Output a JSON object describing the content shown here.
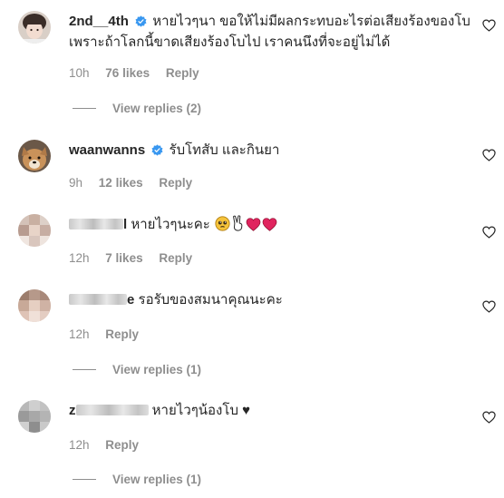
{
  "comments": [
    {
      "username": "2nd__4th",
      "verified": true,
      "text_line1": "หายไวๆนา ขอให้ไม่มีผลกระทบอะไรต่อเสียงร้องของโบ",
      "text_line2": "เพราะถ้าโลกนี้ขาดเสียงร้องโบไป เราคนนึงที่จะอยู่ไม่ได้",
      "time": "10h",
      "likes": "76 likes",
      "reply": "Reply",
      "view_replies": "View replies (2)"
    },
    {
      "username": "waanwanns",
      "verified": true,
      "text": "รับโทสับ และกินยา",
      "time": "9h",
      "likes": "12 likes",
      "reply": "Reply"
    },
    {
      "username_suffix": "l",
      "text": "หายไวๆนะคะ",
      "emojis": [
        "pleading-face",
        "victory-hand",
        "red-heart",
        "red-heart"
      ],
      "time": "12h",
      "likes": "7 likes",
      "reply": "Reply"
    },
    {
      "username_suffix": "e",
      "text": "รอรับของสมนาคุณนะคะ",
      "time": "12h",
      "reply": "Reply",
      "view_replies": "View replies (1)"
    },
    {
      "username_prefix": "z",
      "text": "หายไวๆน้องโบ ♥",
      "time": "12h",
      "reply": "Reply",
      "view_replies": "View replies (1)"
    }
  ],
  "icons": {
    "like": "heart-outline-icon",
    "verified": "verified-badge-icon"
  },
  "colors": {
    "text": "#262626",
    "meta": "#8e8e8e",
    "verified": "#3897f0",
    "heart_emoji": "#e0245e"
  }
}
